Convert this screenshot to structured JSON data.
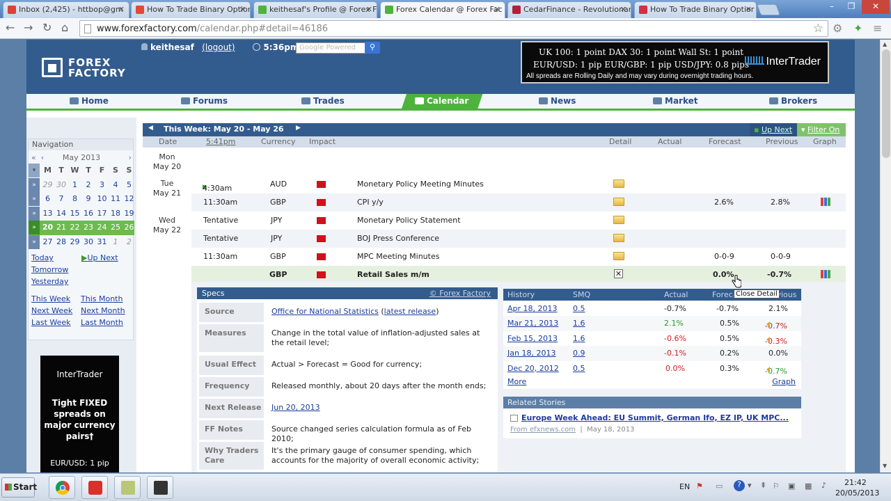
{
  "browser": {
    "tabs": [
      {
        "title": "Inbox (2,425) - httbop@gm",
        "color": "#d44638"
      },
      {
        "title": "How To Trade Binary Optior",
        "color": "#dd4b39"
      },
      {
        "title": "keithesaf's Profile @ Forex F",
        "color": "#4db33d"
      },
      {
        "title": "Forex Calendar @ Forex Fac",
        "color": "#4db33d"
      },
      {
        "title": "CedarFinance - Revolutionar",
        "color": "#b0203a"
      },
      {
        "title": "How To Trade Binary Optior",
        "color": "#cc3344"
      }
    ],
    "url_host": "www.forexfactory.com",
    "url_path": "/calendar.php#detail=46186"
  },
  "header": {
    "logo_text": "FOREX FACTORY",
    "username": "keithesaf",
    "logout": "(logout)",
    "time": "5:36pm",
    "search_placeholder": "Google Powered",
    "banner": {
      "row1": "UK 100: 1 point   DAX 30: 1 point   Wall St: 1 point",
      "row2": "EUR/USD: 1 pip   EUR/GBP: 1 pip   USD/JPY: 0.8 pips",
      "row3": "All spreads are Rolling Daily and may vary during overnight trading hours.",
      "brand": "InterTrader"
    }
  },
  "nav": [
    "Home",
    "Forums",
    "Trades",
    "Calendar",
    "News",
    "Market",
    "Brokers"
  ],
  "sidebar": {
    "title": "Navigation",
    "month": "May 2013",
    "dow": [
      "M",
      "T",
      "W",
      "T",
      "F",
      "S",
      "S"
    ],
    "weeks": [
      [
        "29",
        "30",
        "1",
        "2",
        "3",
        "4",
        "5"
      ],
      [
        "6",
        "7",
        "8",
        "9",
        "10",
        "11",
        "12"
      ],
      [
        "13",
        "14",
        "15",
        "16",
        "17",
        "18",
        "19"
      ],
      [
        "20",
        "21",
        "22",
        "23",
        "24",
        "25",
        "26"
      ],
      [
        "27",
        "28",
        "29",
        "30",
        "31",
        "1",
        "2"
      ]
    ],
    "links": {
      "today": "Today",
      "up_next": "Up Next",
      "tomorrow": "Tomorrow",
      "yesterday": "Yesterday",
      "this_week": "This Week",
      "this_month": "This Month",
      "next_week": "Next Week",
      "next_month": "Next Month",
      "last_week": "Last Week",
      "last_month": "Last Month"
    },
    "ad": {
      "brand": "InterTrader",
      "text": "Tight FIXED spreads on major currency pairs†",
      "footer": "EUR/USD: 1 pip"
    }
  },
  "calendar": {
    "week_label": "This Week: May 20 - May 26",
    "up_next": "Up Next",
    "filter": "Filter On",
    "columns": {
      "date": "Date",
      "time": "5:41pm",
      "currency": "Currency",
      "impact": "Impact",
      "detail": "Detail",
      "actual": "Actual",
      "forecast": "Forecast",
      "previous": "Previous",
      "graph": "Graph"
    },
    "days": [
      {
        "dow": "Mon",
        "date": "May 20"
      },
      {
        "dow": "Tue",
        "date": "May 21"
      },
      {
        "dow": "Wed",
        "date": "May 22"
      }
    ],
    "events": [
      {
        "time": "4:30am",
        "currency": "AUD",
        "event": "Monetary Policy Meeting Minutes",
        "forecast": "",
        "previous": ""
      },
      {
        "time": "11:30am",
        "currency": "GBP",
        "event": "CPI y/y",
        "forecast": "2.6%",
        "previous": "2.8%"
      },
      {
        "time": "Tentative",
        "currency": "JPY",
        "event": "Monetary Policy Statement",
        "forecast": "",
        "previous": ""
      },
      {
        "time": "Tentative",
        "currency": "JPY",
        "event": "BOJ Press Conference",
        "forecast": "",
        "previous": ""
      },
      {
        "time": "11:30am",
        "currency": "GBP",
        "event": "MPC Meeting Minutes",
        "forecast": "0-0-9",
        "previous": "0-0-9"
      },
      {
        "time": "",
        "currency": "GBP",
        "event": "Retail Sales m/m",
        "forecast": "0.0%",
        "previous": "-0.7%"
      }
    ],
    "tooltip": "Close Detail"
  },
  "detail": {
    "specs_title": "Specs",
    "specs_source": "© Forex Factory",
    "specs": [
      {
        "label": "Source",
        "value": "Office for National Statistics",
        "link2": "latest release"
      },
      {
        "label": "Measures",
        "value": "Change in the total value of inflation-adjusted sales at the retail level;"
      },
      {
        "label": "Usual Effect",
        "value": "Actual > Forecast = Good for currency;"
      },
      {
        "label": "Frequency",
        "value": "Released monthly, about 20 days after the month ends;"
      },
      {
        "label": "Next Release",
        "value": "Jun 20, 2013"
      },
      {
        "label": "FF Notes",
        "value": "Source changed series calculation formula as of Feb 2010;"
      },
      {
        "label": "Why Traders Care",
        "value": "It's the primary gauge of consumer spending, which accounts for the majority of overall economic activity;"
      }
    ],
    "history_head": {
      "history": "History",
      "smq": "SMQ",
      "actual": "Actual",
      "forecast": "Forecast",
      "previous": "Previous"
    },
    "history": [
      {
        "date": "Apr 18, 2013",
        "smq": "0.5",
        "actual": "-0.7%",
        "forecast": "-0.7%",
        "previous": "2.1%"
      },
      {
        "date": "Mar 21, 2013",
        "smq": "1.6",
        "actual": "2.1%",
        "forecast": "0.5%",
        "previous": "-0.7%"
      },
      {
        "date": "Feb 15, 2013",
        "smq": "1.6",
        "actual": "-0.6%",
        "forecast": "0.5%",
        "previous": "-0.3%"
      },
      {
        "date": "Jan 18, 2013",
        "smq": "0.9",
        "actual": "-0.1%",
        "forecast": "0.2%",
        "previous": "0.0%"
      },
      {
        "date": "Dec 20, 2012",
        "smq": "0.5",
        "actual": "0.0%",
        "forecast": "0.3%",
        "previous": "-0.7%"
      }
    ],
    "more": "More",
    "graph": "Graph",
    "related_title": "Related Stories",
    "story": "Europe Week Ahead: EU Summit, German Ifo, EZ IP, UK MPC...",
    "story_src": "From efxnews.com",
    "story_date": "May 18, 2013"
  },
  "taskbar": {
    "start": "Start",
    "lang": "EN",
    "time": "21:42",
    "date": "20/05/2013"
  }
}
